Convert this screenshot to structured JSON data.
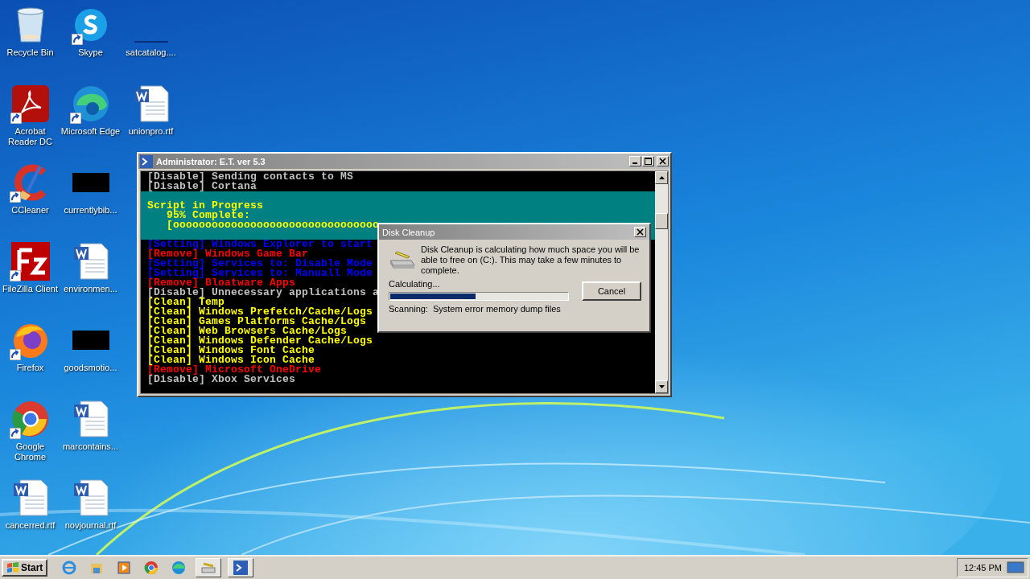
{
  "desktop": {
    "columns": [
      [
        {
          "label": "Recycle Bin",
          "kind": "recycle",
          "shortcut": false
        },
        {
          "label": "Acrobat Reader DC",
          "kind": "acrobat",
          "shortcut": true
        },
        {
          "label": "CCleaner",
          "kind": "ccleaner",
          "shortcut": true
        },
        {
          "label": "FileZilla Client",
          "kind": "filezilla",
          "shortcut": true
        },
        {
          "label": "Firefox",
          "kind": "firefox",
          "shortcut": true
        },
        {
          "label": "Google Chrome",
          "kind": "chrome",
          "shortcut": true
        },
        {
          "label": "cancerred.rtf",
          "kind": "word",
          "shortcut": false
        }
      ],
      [
        {
          "label": "Skype",
          "kind": "skype",
          "shortcut": true
        },
        {
          "label": "Microsoft Edge",
          "kind": "edge",
          "shortcut": true
        },
        {
          "label": "currentlybib...",
          "kind": "black",
          "shortcut": false
        },
        {
          "label": "environmen...",
          "kind": "word",
          "shortcut": false
        },
        {
          "label": "goodsmotio...",
          "kind": "black",
          "shortcut": false
        },
        {
          "label": "marcontains...",
          "kind": "word",
          "shortcut": false
        },
        {
          "label": "novjournal.rtf",
          "kind": "word",
          "shortcut": false
        }
      ],
      [
        {
          "label": "satcatalog....",
          "kind": "blank",
          "shortcut": false
        },
        {
          "label": "unionpro.rtf",
          "kind": "word",
          "shortcut": false
        }
      ]
    ]
  },
  "console_window": {
    "title": "Administrator: E.T. ver 5.3",
    "lines": [
      {
        "kind": "line",
        "text": "[Disable] Sending contacts to MS",
        "color": "#c0c0c0"
      },
      {
        "kind": "line",
        "text": "[Disable] Cortana",
        "color": "#c0c0c0"
      },
      {
        "kind": "banner",
        "lines": [
          "Script in Progress",
          "   95% Complete:",
          "   [oooooooooooooooooooooooooooooooo"
        ]
      },
      {
        "kind": "line",
        "text": "[Setting] Windows Explorer to start",
        "color": "#0000ff"
      },
      {
        "kind": "line",
        "text": "[Remove] Windows Game Bar",
        "color": "#ff0000"
      },
      {
        "kind": "line",
        "text": "[Setting] Services to: Disable Mode",
        "color": "#0000ff"
      },
      {
        "kind": "line",
        "text": "[Setting] Services to: Manuall Mode",
        "color": "#0000ff"
      },
      {
        "kind": "line",
        "text": "[Remove] Bloatware Apps",
        "color": "#ff0000"
      },
      {
        "kind": "line",
        "text": "[Disable] Unnecessary applications a",
        "color": "#c0c0c0"
      },
      {
        "kind": "line",
        "text": "[Clean] Temp",
        "color": "#ffff00"
      },
      {
        "kind": "line",
        "text": "[Clean] Windows Prefetch/Cache/Logs",
        "color": "#ffff00"
      },
      {
        "kind": "line",
        "text": "[Clean] Games Platforms Cache/Logs",
        "color": "#ffff00"
      },
      {
        "kind": "line",
        "text": "[Clean] Web Browsers Cache/Logs",
        "color": "#ffff00"
      },
      {
        "kind": "line",
        "text": "[Clean] Windows Defender Cache/Logs",
        "color": "#ffff00"
      },
      {
        "kind": "line",
        "text": "[Clean] Windows Font Cache",
        "color": "#ffff00"
      },
      {
        "kind": "line",
        "text": "[Clean] Windows Icon Cache",
        "color": "#ffff00"
      },
      {
        "kind": "line",
        "text": "[Remove] Microsoft OneDrive",
        "color": "#ff0000"
      },
      {
        "kind": "line",
        "text": "[Disable] Xbox Services",
        "color": "#c0c0c0"
      }
    ]
  },
  "dialog": {
    "title": "Disk Cleanup",
    "message": "Disk Cleanup is calculating how much space you will be able to free on  (C:). This may take a few minutes to complete.",
    "status": "Calculating...",
    "progress": {
      "level": 0.48
    },
    "cancel_button": "Cancel",
    "scanning_label": "Scanning:",
    "scanning_item": "System error memory dump files"
  },
  "taskbar": {
    "start_button": "Start",
    "icons": [
      {
        "kind": "ie",
        "active": false
      },
      {
        "kind": "folder",
        "active": false
      },
      {
        "kind": "media",
        "active": false
      },
      {
        "kind": "chrome",
        "active": false
      },
      {
        "kind": "edge",
        "active": false
      },
      {
        "kind": "cleanup",
        "active": true
      },
      {
        "kind": "console",
        "active": true
      }
    ],
    "clock": "12:45 PM"
  }
}
